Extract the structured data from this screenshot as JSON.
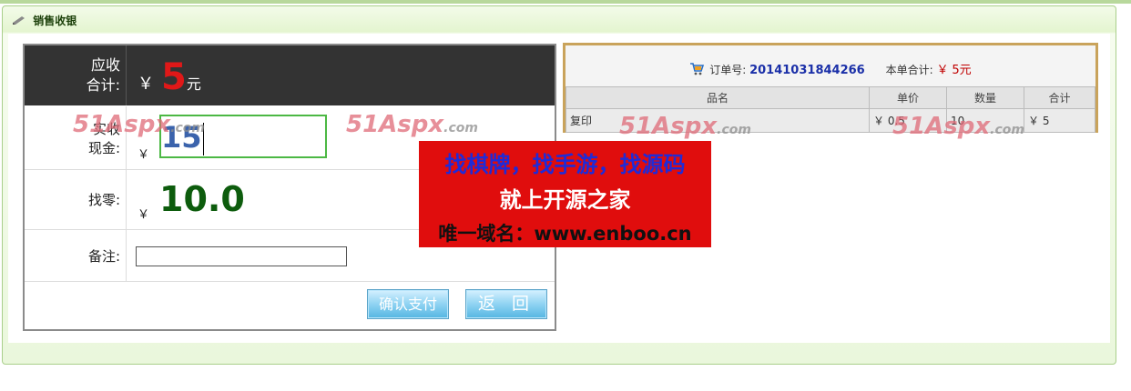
{
  "panel": {
    "title": "销售收银"
  },
  "payment": {
    "total_label_line1": "应收",
    "total_label_line2": "合计:",
    "total_currency": "￥",
    "total_amount": "5",
    "total_unit": "元",
    "cash_label_line1": "实收",
    "cash_label_line2": "现金:",
    "cash_currency": "￥",
    "cash_value": "15",
    "change_label": "找零:",
    "change_currency": "￥",
    "change_value": "10.0",
    "remark_label": "备注:",
    "remark_value": "",
    "confirm_button": "确认支付",
    "back_button": "返 回"
  },
  "order": {
    "order_no_label": "订单号:",
    "order_no": "20141031844266",
    "subtotal_label": "本单合计:",
    "subtotal_currency": "￥",
    "subtotal_amount": "5元",
    "columns": [
      "品名",
      "单价",
      "数量",
      "合计"
    ],
    "rows": [
      [
        "复印",
        "￥ 0.5",
        "10",
        "￥ 5"
      ]
    ]
  },
  "watermark": {
    "brand": "51Aspx",
    "suffix": ".com"
  },
  "ad": {
    "line1": "找棋牌，找手游，找源码",
    "line2": "就上开源之家",
    "line3": "唯一域名：www.enboo.cn"
  },
  "colors": {
    "total_amount": "#e01818",
    "change_value": "#0d5c0d",
    "cash_value": "#3b63ac",
    "order_no": "#1a2fa8",
    "ad_background": "#e00d0d"
  }
}
